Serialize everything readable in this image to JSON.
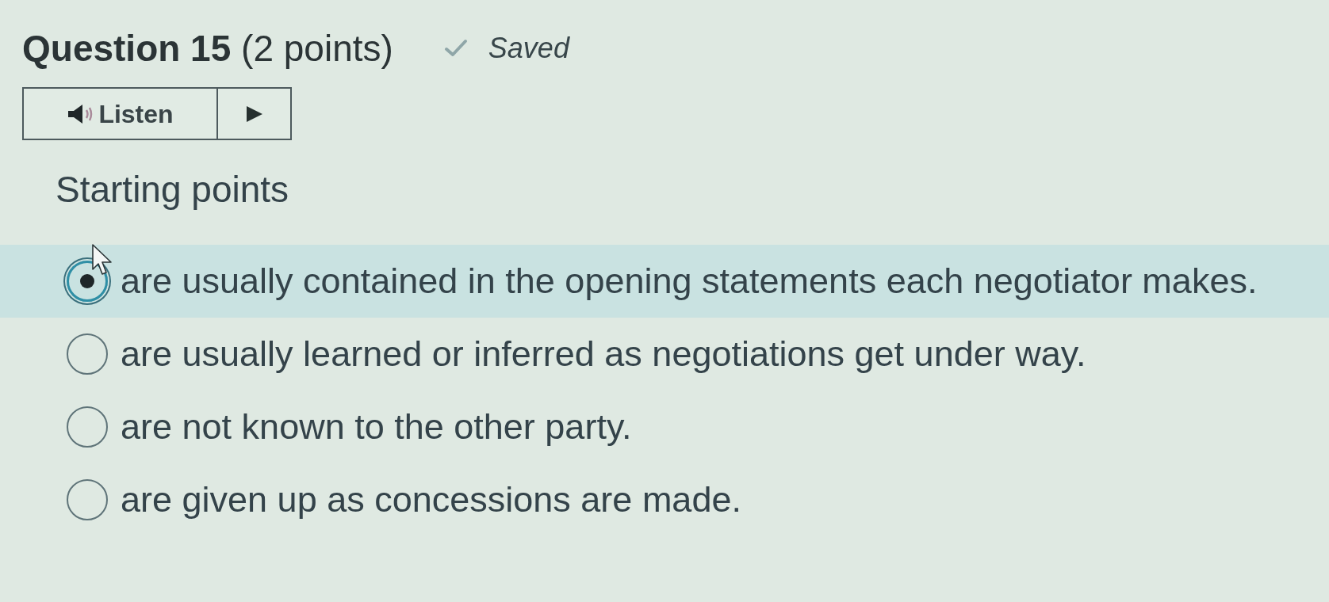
{
  "question": {
    "title": "**Question 15** (2 points)",
    "save_status": "Saved"
  },
  "listen_bar": {
    "label": "Listen"
  },
  "prompt": "Starting points",
  "options": [
    {
      "text": "are usually contained in the opening statements each negotiator makes.",
      "selected": true
    },
    {
      "text": "are usually learned or inferred as negotiations get under way.",
      "selected": false
    },
    {
      "text": "are not known to the other party.",
      "selected": false
    },
    {
      "text": "are given up as concessions are made.",
      "selected": false
    }
  ]
}
